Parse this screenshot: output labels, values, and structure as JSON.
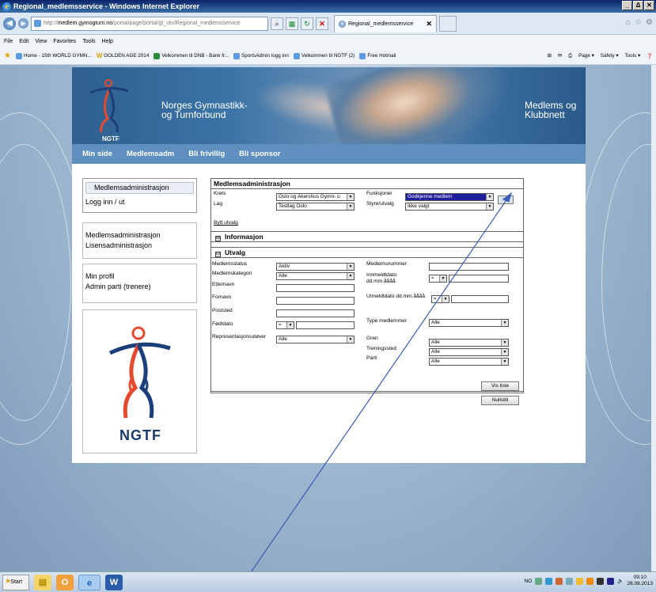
{
  "window": {
    "title": "Regional_medlemsservice - Windows Internet Explorer",
    "controls": [
      "_",
      "Δ",
      "✕"
    ]
  },
  "address": {
    "url_prefix": "http://",
    "url_host": "medlem.gymogturn.no",
    "url_path": "/portal/page/portal/gt_utv/Regional_medlemsservice",
    "tab_label": "Regional_medlemsservice"
  },
  "menu": [
    "File",
    "Edit",
    "View",
    "Favorites",
    "Tools",
    "Help"
  ],
  "favorites": [
    "Home - 15th WORLD GYMN...",
    "GOLDEN AGE 2014",
    "Velkommen til DNB - Bank fr...",
    "SportsAdmin logg inn",
    "Velkommen til NGTF (2)",
    "Free Hotmail"
  ],
  "commandbar": [
    "Page ▾",
    "Safety ▾",
    "Tools ▾"
  ],
  "site": {
    "logo_text": "NGTF",
    "org_line1": "Norges Gymnastikk-",
    "org_line2": "og Turnforbund",
    "right_line1": "Medlems og",
    "right_line2": "Klubbnett",
    "nav": [
      "Min side",
      "Medlemsadm",
      "Bli frivillig",
      "Bli sponsor"
    ],
    "left": {
      "active_head": "Medlemsadministrasjon",
      "login": "Logg inn / ut",
      "group2": [
        "Medlemsadministrasjon",
        "Lisensadministrasjon"
      ],
      "group3": [
        "Min profil",
        "Admin parti (trenere)"
      ],
      "big_logo_text": "NGTF"
    }
  },
  "form": {
    "title": "Medlemsadministrasjon",
    "krets_label": "Krets",
    "krets_value": "Oslo og Akershus Gymn- o",
    "lag_label": "Lag",
    "lag_value": "Testlag Oslo",
    "bytt_link": "Bytt utvalg",
    "funksjoner_label": "Funksjoner",
    "funksjoner_value": "Godkjenne medlem",
    "styre_label": "Styre/utvalg",
    "styre_value": "Ikke valgt",
    "go_button": ">>>",
    "section_info": "Informasjon",
    "section_utvalg": "Utvalg",
    "expand_symbol": "⊞",
    "collapse_symbol": "⊟",
    "fields_left": {
      "status_label": "Medlemsstatus",
      "status_value": "Aktiv",
      "kategori_label": "Medlemskategori",
      "kategori_value": "Alle",
      "etternavn_label": "Etternavn",
      "fornavn_label": "Fornavn",
      "poststed_label": "Poststed",
      "fodt_label": "Fødtdato",
      "fodt_op": "=",
      "repr_label": "Representasjonsutøver",
      "repr_value": "Alle"
    },
    "fields_right": {
      "nr_label": "Medlemsnummer",
      "inn_label_1": "Innmeldtdato",
      "inn_label_2": "dd.mm.åååå",
      "inn_op": "=",
      "utm_label": "Utmeldtdato dd.mm.åååå",
      "utm_op": "=",
      "type_label": "Type medlemmer",
      "type_value": "Alle",
      "gren_label": "Gren",
      "gren_value": "Alle",
      "trening_label": "Treningssted",
      "trening_value": "Alle",
      "parti_label": "Parti",
      "parti_value": "Alle"
    },
    "vis_liste": "Vis liste",
    "nullstill": "Nullstill"
  },
  "taskbar": {
    "start": "Start",
    "lang": "NO",
    "time": "09:10",
    "date": "26.08.2013"
  }
}
